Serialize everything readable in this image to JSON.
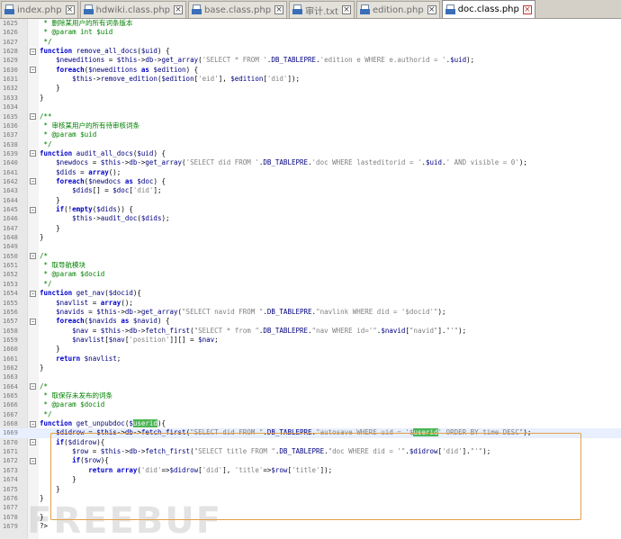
{
  "tabs": [
    {
      "label": "index.php",
      "active": false
    },
    {
      "label": "hdwiki.class.php",
      "active": false
    },
    {
      "label": "base.class.php",
      "active": false
    },
    {
      "label": "审计.txt",
      "active": false
    },
    {
      "label": "edition.php",
      "active": false
    },
    {
      "label": "doc.class.php",
      "active": true
    }
  ],
  "watermark": "FREEBUF",
  "lines": [
    {
      "n": "1625",
      "t": " * 删除某用户的所有词条版本",
      "k": "comment"
    },
    {
      "n": "1626",
      "t": " * @param int $uid",
      "k": "comment"
    },
    {
      "n": "1627",
      "t": " */",
      "k": "comment"
    },
    {
      "n": "1628",
      "t": "function remove_all_docs($uid) {",
      "k": "code"
    },
    {
      "n": "1629",
      "t": "    $neweditions = $this->db->get_array('SELECT * FROM '.DB_TABLEPRE.'edition e WHERE e.authorid = '.$uid);",
      "k": "code"
    },
    {
      "n": "1630",
      "t": "    foreach($neweditions as $edition) {",
      "k": "code"
    },
    {
      "n": "1631",
      "t": "        $this->remove_edition($edition['eid'], $edition['did']);",
      "k": "code"
    },
    {
      "n": "1632",
      "t": "    }",
      "k": "code"
    },
    {
      "n": "1633",
      "t": "}",
      "k": "code"
    },
    {
      "n": "1634",
      "t": "",
      "k": "code"
    },
    {
      "n": "1635",
      "t": "/**",
      "k": "comment"
    },
    {
      "n": "1636",
      "t": " * 审核某用户的所有待审核词条",
      "k": "comment"
    },
    {
      "n": "1637",
      "t": " * @param $uid",
      "k": "comment"
    },
    {
      "n": "1638",
      "t": " */",
      "k": "comment"
    },
    {
      "n": "1639",
      "t": "function audit_all_docs($uid) {",
      "k": "code"
    },
    {
      "n": "1640",
      "t": "    $newdocs = $this->db->get_array('SELECT did FROM '.DB_TABLEPRE.'doc WHERE lasteditorid = '.$uid.' AND visible = 0');",
      "k": "code"
    },
    {
      "n": "1641",
      "t": "    $dids = array();",
      "k": "code"
    },
    {
      "n": "1642",
      "t": "    foreach($newdocs as $doc) {",
      "k": "code"
    },
    {
      "n": "1643",
      "t": "        $dids[] = $doc['did'];",
      "k": "code"
    },
    {
      "n": "1644",
      "t": "    }",
      "k": "code"
    },
    {
      "n": "1645",
      "t": "    if(!empty($dids)) {",
      "k": "code"
    },
    {
      "n": "1646",
      "t": "        $this->audit_doc($dids);",
      "k": "code"
    },
    {
      "n": "1647",
      "t": "    }",
      "k": "code"
    },
    {
      "n": "1648",
      "t": "}",
      "k": "code"
    },
    {
      "n": "1649",
      "t": "",
      "k": "code"
    },
    {
      "n": "1650",
      "t": "/*",
      "k": "comment"
    },
    {
      "n": "1651",
      "t": " * 取导航模块",
      "k": "comment"
    },
    {
      "n": "1652",
      "t": " * @param $docid",
      "k": "comment"
    },
    {
      "n": "1653",
      "t": " */",
      "k": "comment"
    },
    {
      "n": "1654",
      "t": "function get_nav($docid){",
      "k": "code"
    },
    {
      "n": "1655",
      "t": "    $navlist = array();",
      "k": "code"
    },
    {
      "n": "1656",
      "t": "    $navids = $this->db->get_array(\"SELECT navid FROM \".DB_TABLEPRE.\"navlink WHERE did = '$docid'\");",
      "k": "code"
    },
    {
      "n": "1657",
      "t": "    foreach($navids as $navid) {",
      "k": "code"
    },
    {
      "n": "1658",
      "t": "        $nav = $this->db->fetch_first(\"SELECT * from \".DB_TABLEPRE.\"nav WHERE id='\".$navid[\"navid\"].\"'\");",
      "k": "code"
    },
    {
      "n": "1659",
      "t": "        $navlist[$nav['position']][] = $nav;",
      "k": "code"
    },
    {
      "n": "1660",
      "t": "    }",
      "k": "code"
    },
    {
      "n": "1661",
      "t": "    return $navlist;",
      "k": "code"
    },
    {
      "n": "1662",
      "t": "}",
      "k": "code"
    },
    {
      "n": "1663",
      "t": "",
      "k": "code"
    },
    {
      "n": "1664",
      "t": "/*",
      "k": "comment"
    },
    {
      "n": "1665",
      "t": " * 取保存未发布的词条",
      "k": "comment"
    },
    {
      "n": "1666",
      "t": " * @param $docid",
      "k": "comment"
    },
    {
      "n": "1667",
      "t": " */",
      "k": "comment"
    },
    {
      "n": "1668",
      "t": "function get_unpubdoc($userid){",
      "k": "code"
    },
    {
      "n": "1669",
      "t": "    $didrow = $this->db->fetch_first(\"SELECT did FROM \".DB_TABLEPRE.\"autosave WHERE uid = '$userid' ORDER BY time DESC\");",
      "k": "code"
    },
    {
      "n": "1670",
      "t": "    if($didrow){",
      "k": "code"
    },
    {
      "n": "1671",
      "t": "        $row = $this->db->fetch_first(\"SELECT title FROM \".DB_TABLEPRE.\"doc WHERE did = '\".$didrow['did'].\"'\");",
      "k": "code"
    },
    {
      "n": "1672",
      "t": "        if($row){",
      "k": "code"
    },
    {
      "n": "1673",
      "t": "            return array('did'=>$didrow['did'], 'title'=>$row['title']);",
      "k": "code"
    },
    {
      "n": "1674",
      "t": "        }",
      "k": "code"
    },
    {
      "n": "1675",
      "t": "    }",
      "k": "code"
    },
    {
      "n": "1676",
      "t": "}",
      "k": "code"
    },
    {
      "n": "1677",
      "t": "",
      "k": "code"
    },
    {
      "n": "1678",
      "t": "}",
      "k": "code"
    },
    {
      "n": "1679",
      "t": "?>",
      "k": "code"
    }
  ],
  "highlight_word": "userid",
  "colors": {
    "keyword": "#0000cc",
    "comment": "#008000",
    "string": "#808080",
    "variable": "#000080",
    "box": "#e2a04a",
    "match": "#4ab552"
  }
}
